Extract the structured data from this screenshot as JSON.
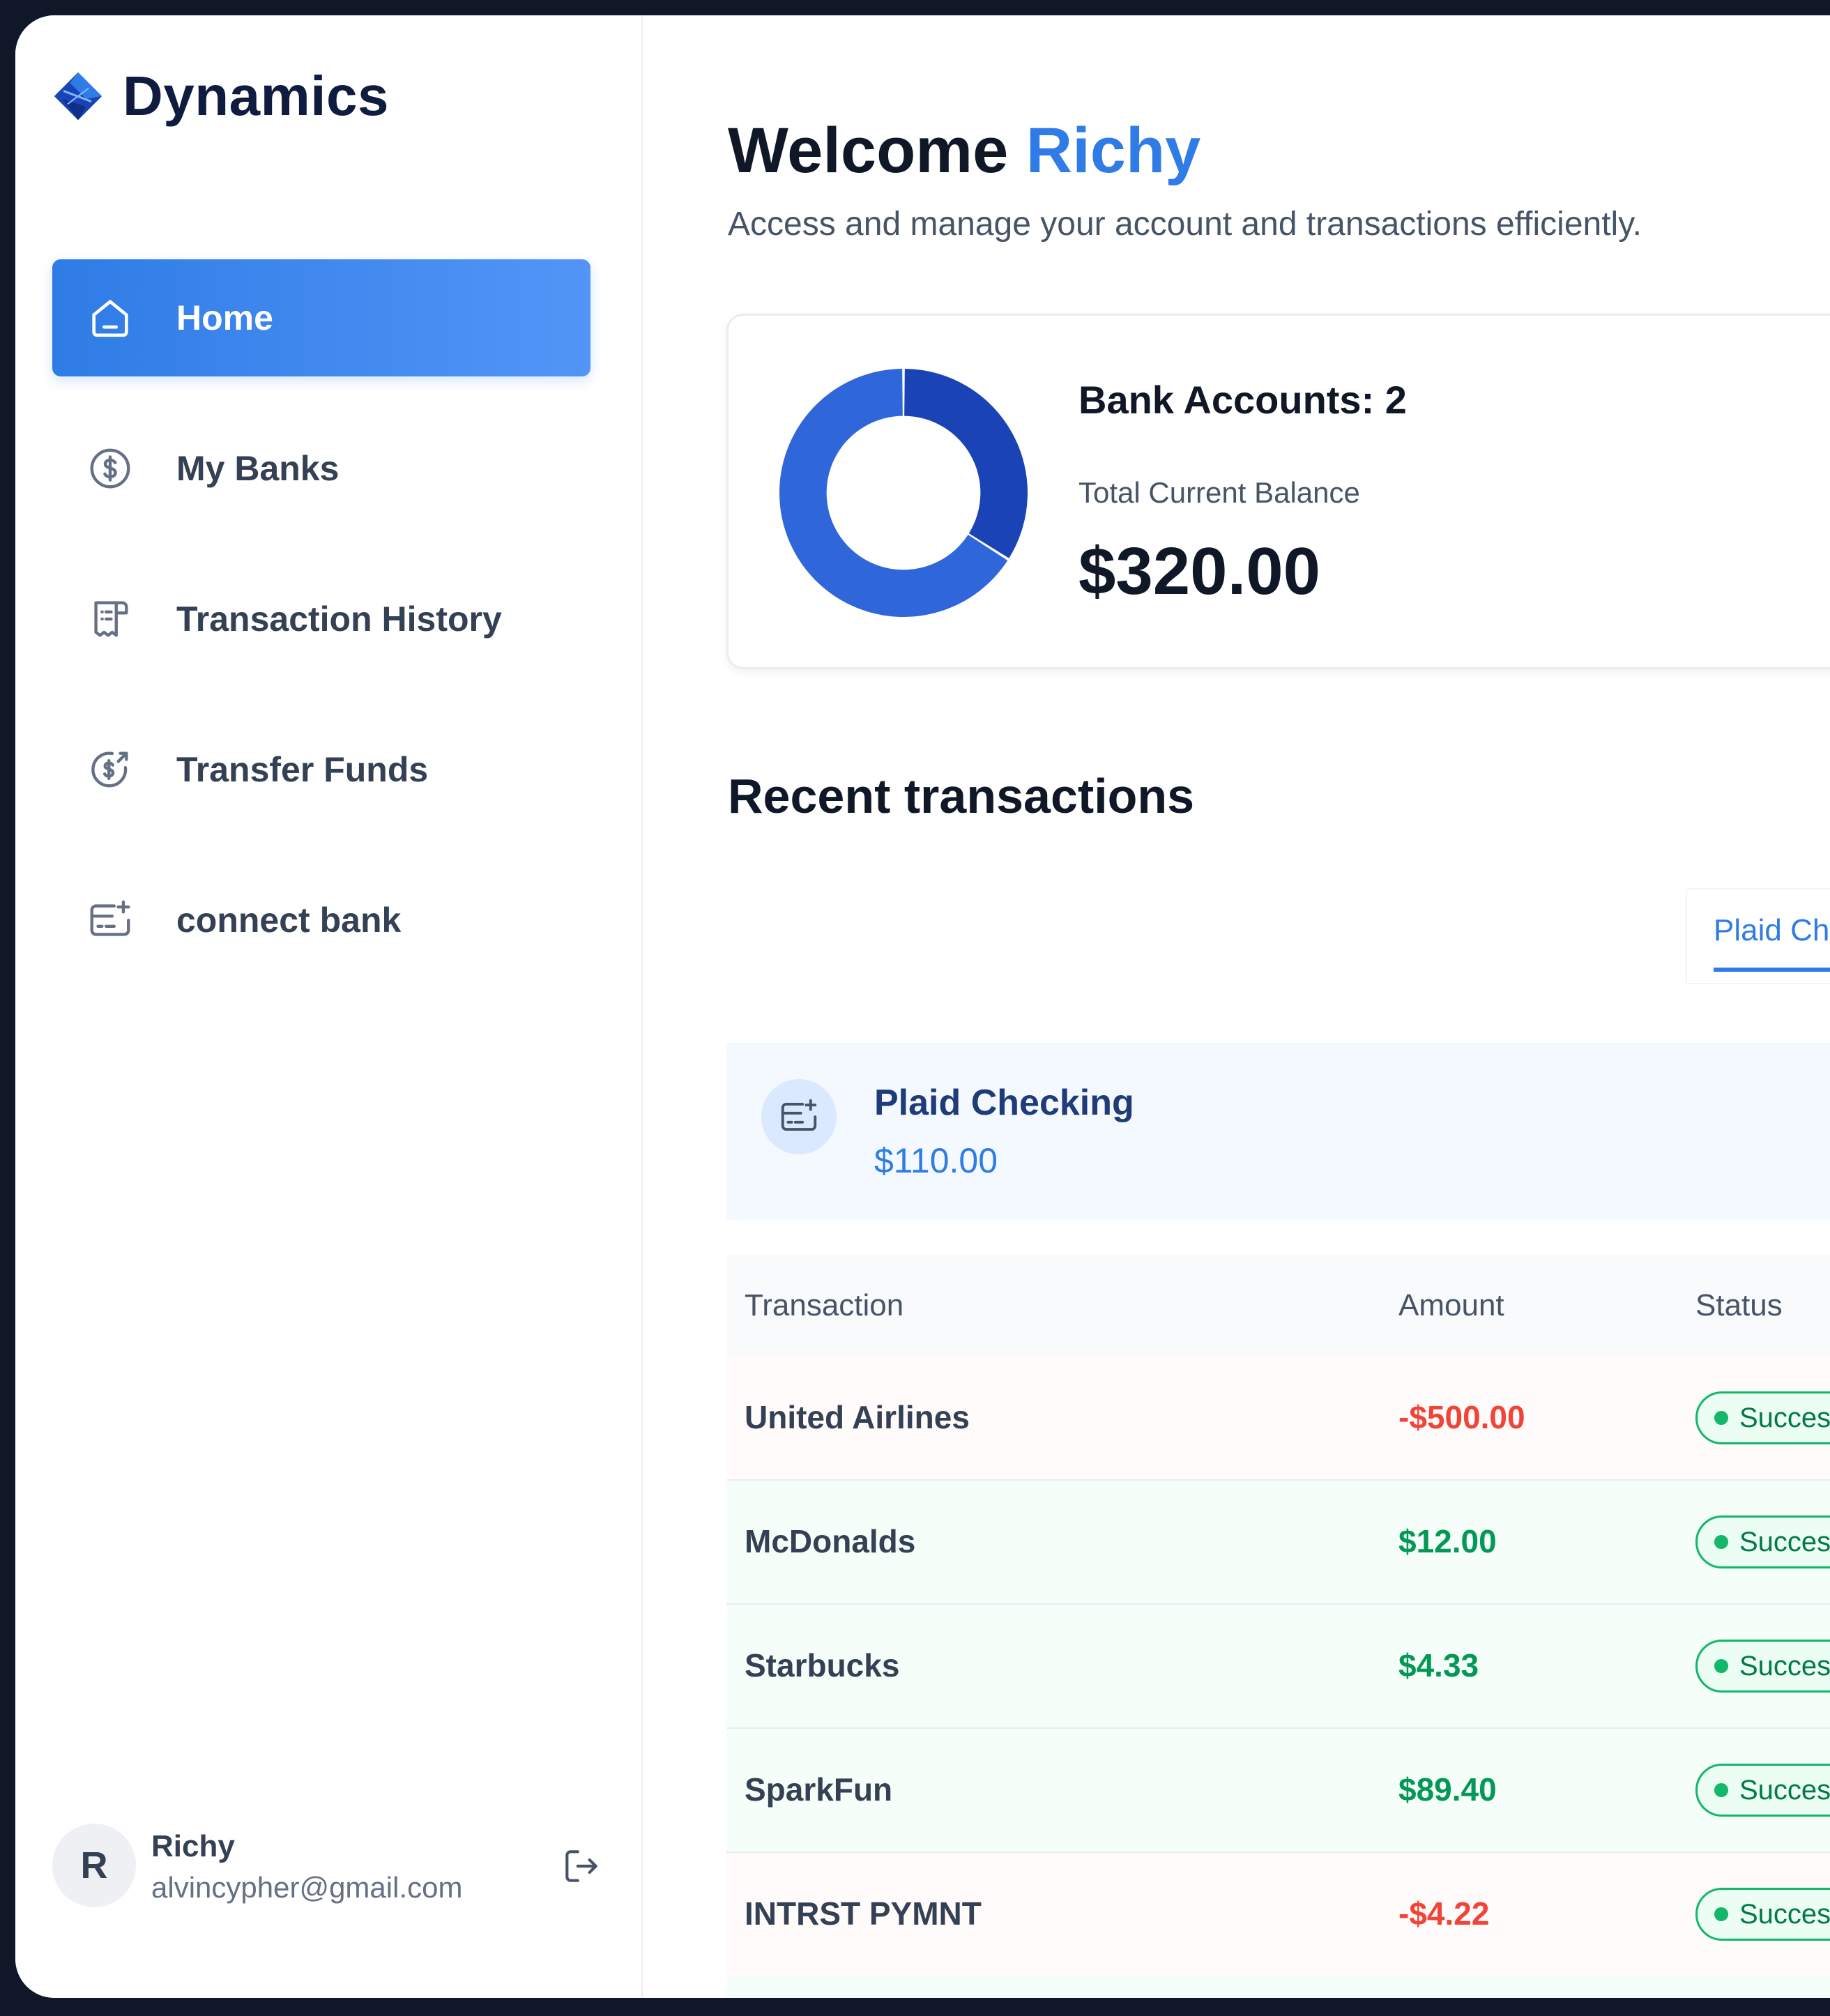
{
  "app": {
    "name": "Dynamics",
    "logo_icon": "diamond-logo-icon",
    "accent_color": "#2f7ce6"
  },
  "sidebar": {
    "items": [
      {
        "label": "Home",
        "icon": "home-icon",
        "active": true
      },
      {
        "label": "My Banks",
        "icon": "dollar-circle-icon",
        "active": false
      },
      {
        "label": "Transaction History",
        "icon": "receipt-icon",
        "active": false
      },
      {
        "label": "Transfer Funds",
        "icon": "money-send-icon",
        "active": false
      },
      {
        "label": "connect bank",
        "icon": "card-add-icon",
        "active": false
      }
    ]
  },
  "user": {
    "initial": "R",
    "name": "Richy",
    "email": "alvincypher@gmail.com",
    "logout_icon": "logout-icon"
  },
  "header": {
    "greeting": "Welcome",
    "user_name": "Richy",
    "subtitle": "Access and manage your account and transactions efficiently."
  },
  "balance_card": {
    "bank_accounts_text": "Bank Accounts: 2",
    "balance_label": "Total Current Balance",
    "balance_value": "$320.00",
    "donut_segments": [
      {
        "share": 0.34,
        "color": "#1a44b5"
      },
      {
        "share": 0.66,
        "color": "#2f66d9"
      }
    ]
  },
  "recent": {
    "title": "Recent transactions",
    "tabs": [
      {
        "label": "Plaid Ch",
        "active": true
      }
    ],
    "account": {
      "icon": "card-add-icon",
      "name": "Plaid Checking",
      "balance": "$110.00"
    },
    "columns": [
      "Transaction",
      "Amount",
      "Status"
    ],
    "transactions": [
      {
        "name": "United Airlines",
        "amount": "-$500.00",
        "type": "debit",
        "status": "Success"
      },
      {
        "name": "McDonalds",
        "amount": "$12.00",
        "type": "credit",
        "status": "Success"
      },
      {
        "name": "Starbucks",
        "amount": "$4.33",
        "type": "credit",
        "status": "Success"
      },
      {
        "name": "SparkFun",
        "amount": "$89.40",
        "type": "credit",
        "status": "Success"
      },
      {
        "name": "INTRST PYMNT",
        "amount": "-$4.22",
        "type": "debit",
        "status": "Success"
      }
    ]
  }
}
